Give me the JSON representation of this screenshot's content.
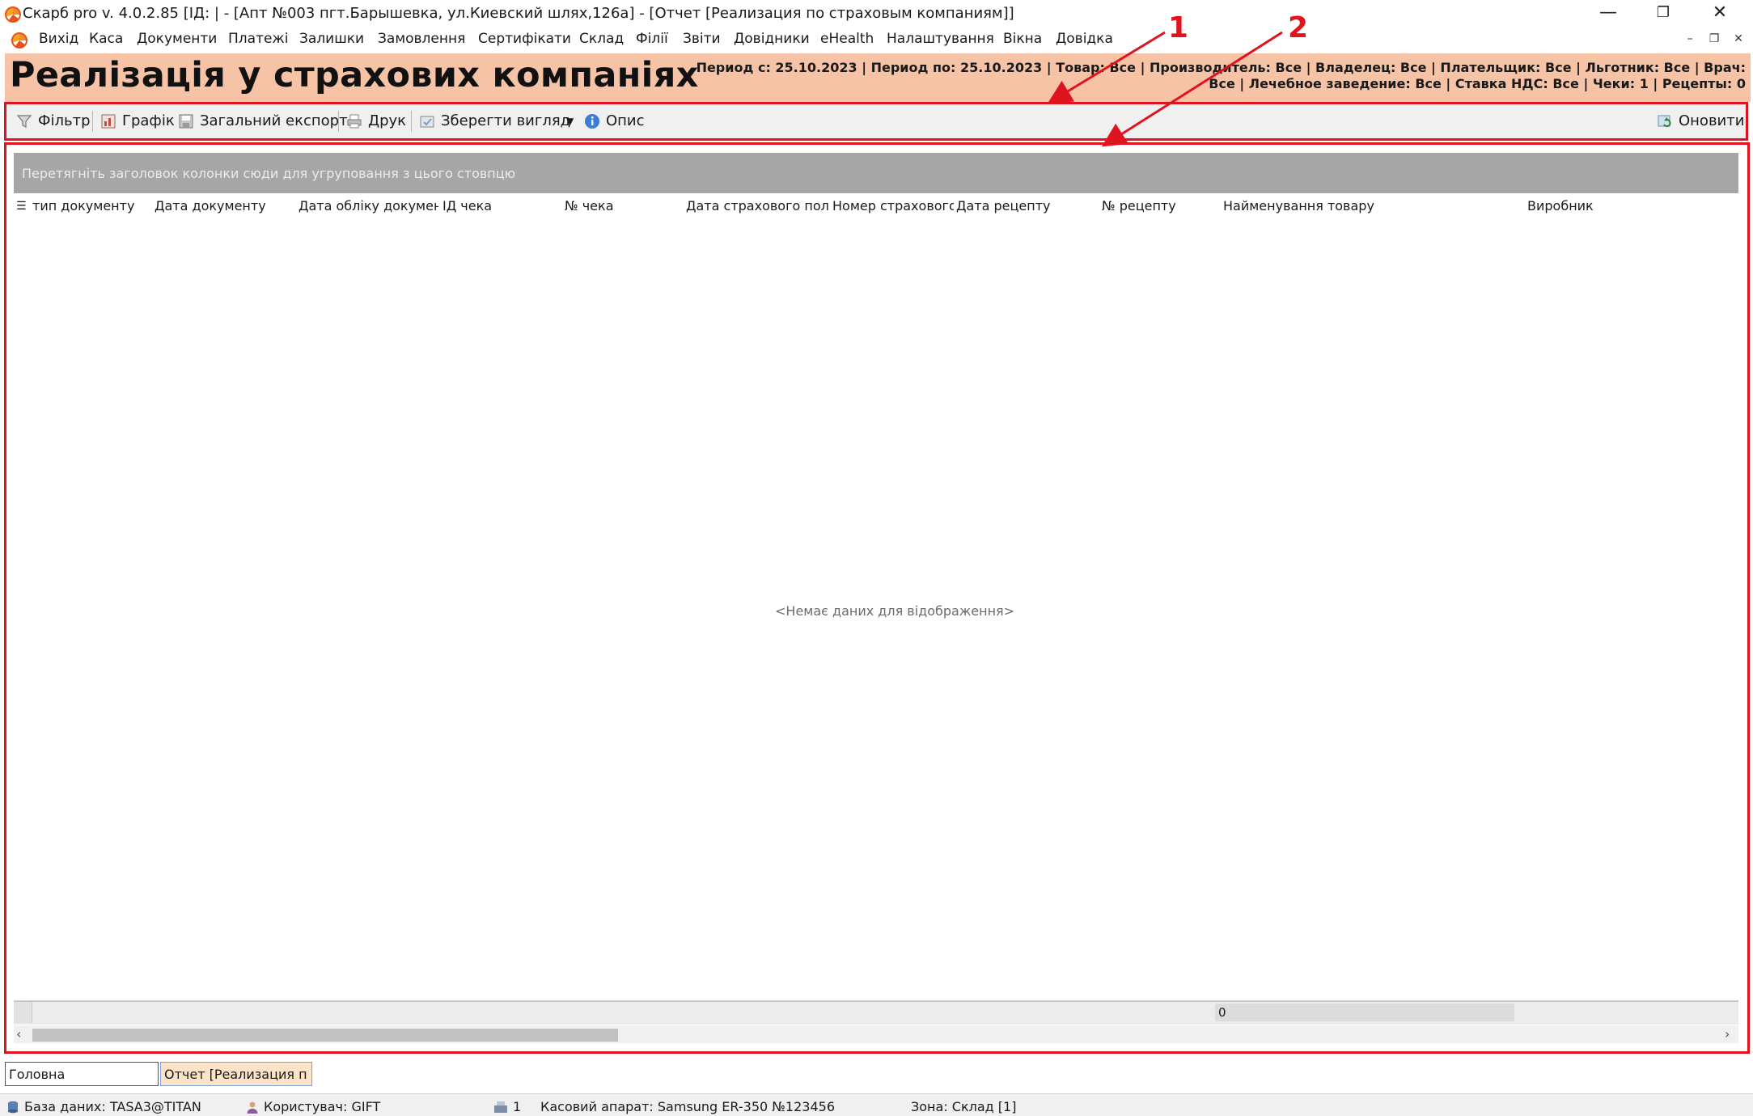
{
  "window": {
    "title": "Скарб pro v. 4.0.2.85 [ІД:        | - [Апт №003 пгт.Барышевка, ул.Киевский шлях,126а] - [Отчет [Реализация по страховым компаниям]]"
  },
  "menu": {
    "items": [
      "Вихід",
      "Каса",
      "Документи",
      "Платежі",
      "Залишки",
      "Замовлення",
      "Сертифікати",
      "Склад",
      "Філії",
      "Звіти",
      "Довідники",
      "eHealth",
      "Налаштування",
      "Вікна",
      "Довідка"
    ]
  },
  "header": {
    "title": "Реалізація у страхових компаніях",
    "info_line1": "Период с: 25.10.2023 | Период по: 25.10.2023 | Товар: Все | Производитель: Все | Владелец: Все | Плательщик: Все | Льготник: Все | Врач:",
    "info_line2": "Все | Лечебное заведение: Все | Ставка НДС: Все | Чеки: 1 | Рецепты: 0"
  },
  "toolbar": {
    "filter": "Фільтр",
    "chart": "Графік",
    "export": "Загальний експорт",
    "print": "Друк",
    "save_view": "Зберегти вигляд",
    "description": "Опис",
    "refresh": "Оновити"
  },
  "grid": {
    "group_hint": "Перетягніть заголовок колонки сюди для угруповання з цього стовпцю",
    "columns": [
      "тип документу",
      "Дата документу",
      "Дата обліку документа",
      "ІД чека",
      "№ чека",
      "Дата страхового поліса",
      "Номер страхового",
      "Дата рецепту",
      "№ рецепту",
      "Найменування товару",
      "Виробник"
    ],
    "empty_text": "<Немає даних для відображення>",
    "footer_value": "0"
  },
  "annotations": {
    "label1": "1",
    "label2": "2"
  },
  "tabs": [
    "Головна",
    "Отчет [Реализация п ..."
  ],
  "status": {
    "database": "База даних: TASA3@TITAN",
    "user": "Користувач: GIFT",
    "count": "1",
    "cash_register": "Касовий апарат: Samsung ER-350 №123456",
    "zone": "Зона: Склад [1]"
  },
  "colors": {
    "header_bg": "#f6c3a7",
    "annotation_red": "#e0141e",
    "group_panel": "#a6a6a6",
    "active_tab": "#fde3c8"
  }
}
